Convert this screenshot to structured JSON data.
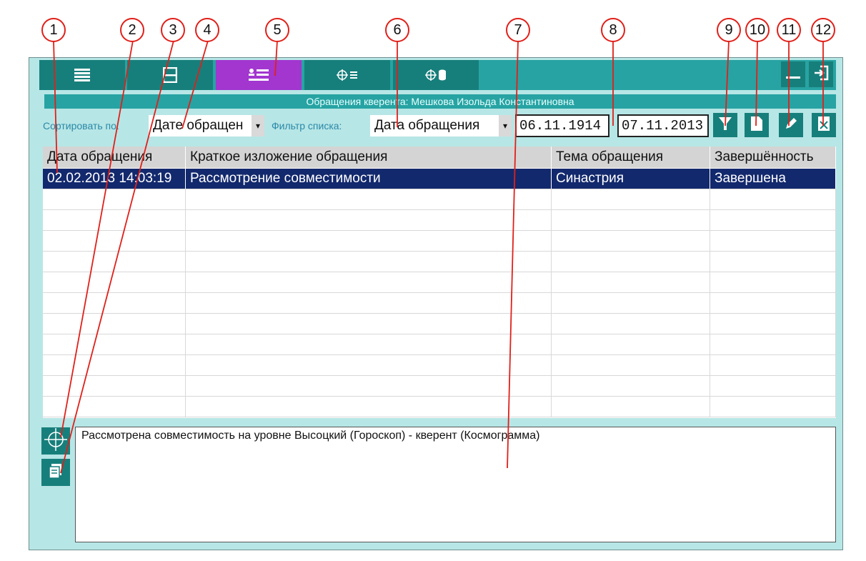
{
  "toolbar": {
    "tabs": [
      {
        "icon": "list-lines-icon"
      },
      {
        "icon": "person-card-icon"
      },
      {
        "icon": "person-list-icon",
        "active": true
      },
      {
        "icon": "cross-list-icon"
      },
      {
        "icon": "cross-database-icon"
      }
    ],
    "window_buttons": [
      {
        "icon": "minimize-icon"
      },
      {
        "icon": "exit-icon"
      }
    ]
  },
  "title": "Обращения кверента: Мешкова Изольда Константиновна",
  "filter_bar": {
    "sort_label": "Сортировать по:",
    "sort_value": "Дате обращен",
    "filter_label": "Фильтр списка:",
    "filter_value": "Дата обращения",
    "date_from": "06.11.1914",
    "date_to": "07.11.2013",
    "buttons": [
      "filter-funnel-icon",
      "new-document-icon",
      "edit-pencil-icon",
      "delete-icon"
    ]
  },
  "table": {
    "columns": [
      "Дата обращения",
      "Краткое изложение обращения",
      "Тема обращения",
      "Завершённость"
    ],
    "rows": [
      [
        "02.02.2013 14:03:19",
        "Рассмотрение совместимости",
        "Синастрия",
        "Завершена"
      ]
    ]
  },
  "memo": "Рассмотрена совместимость на уровне Высоцкий (Гороскоп) - кверент (Космограмма)",
  "side_buttons": [
    "crosshair-icon",
    "documents-icon"
  ],
  "callouts": [
    "1",
    "2",
    "3",
    "4",
    "5",
    "6",
    "7",
    "8",
    "9",
    "10",
    "11",
    "12"
  ],
  "colors": {
    "accent_teal": "#27a3a3",
    "active_tab": "#a236cf",
    "selected_row": "#13296d",
    "callout_red": "#e0201a"
  }
}
